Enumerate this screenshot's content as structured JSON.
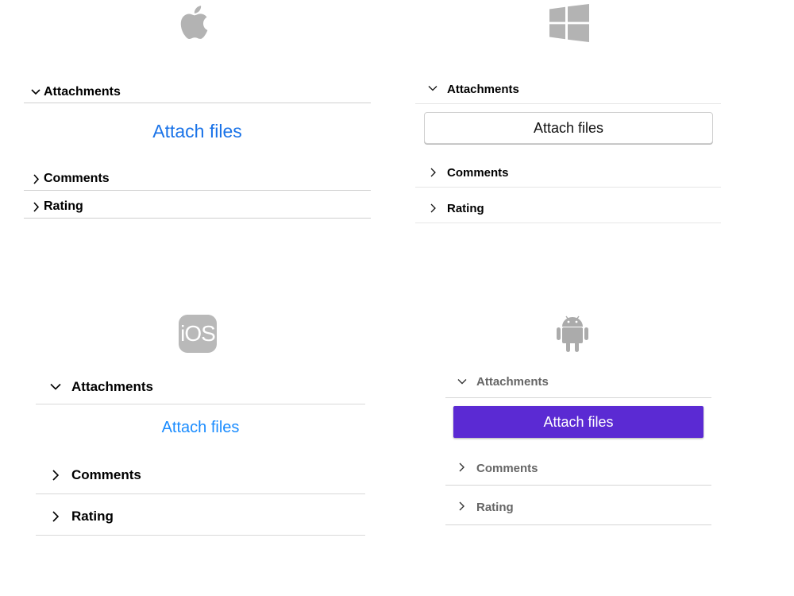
{
  "platforms": {
    "macos": {
      "logo_icon": "apple-logo-icon",
      "sections": [
        {
          "label": "Attachments",
          "expanded": true
        },
        {
          "label": "Comments",
          "expanded": false
        },
        {
          "label": "Rating",
          "expanded": false
        }
      ],
      "attach_button_label": "Attach files",
      "accent_color": "#1a73e8"
    },
    "windows": {
      "logo_icon": "windows-logo-icon",
      "sections": [
        {
          "label": "Attachments",
          "expanded": true
        },
        {
          "label": "Comments",
          "expanded": false
        },
        {
          "label": "Rating",
          "expanded": false
        }
      ],
      "attach_button_label": "Attach files"
    },
    "ios": {
      "logo_icon": "ios-logo-icon",
      "logo_text": "iOS",
      "sections": [
        {
          "label": "Attachments",
          "expanded": true
        },
        {
          "label": "Comments",
          "expanded": false
        },
        {
          "label": "Rating",
          "expanded": false
        }
      ],
      "attach_button_label": "Attach files",
      "accent_color": "#1a8cff"
    },
    "android": {
      "logo_icon": "android-logo-icon",
      "sections": [
        {
          "label": "Attachments",
          "expanded": true
        },
        {
          "label": "Comments",
          "expanded": false
        },
        {
          "label": "Rating",
          "expanded": false
        }
      ],
      "attach_button_label": "Attach files",
      "accent_color": "#5b2ad3"
    }
  }
}
